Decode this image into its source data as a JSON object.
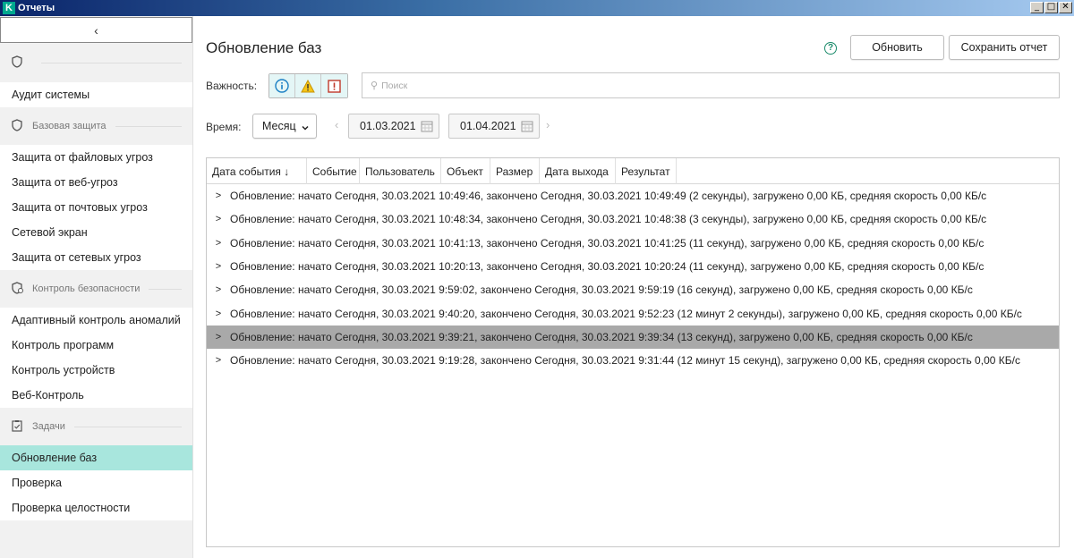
{
  "window": {
    "title": "Отчеты",
    "logo": "K",
    "controls": [
      "_",
      "□",
      "✕"
    ]
  },
  "sidebar": {
    "collapse_icon": "‹",
    "groups": [
      {
        "label": "",
        "icon": "shield-icon",
        "items": [
          "Аудит системы"
        ]
      },
      {
        "label": "Базовая защита",
        "icon": "shield-icon",
        "items": [
          "Защита от файловых угроз",
          "Защита от веб-угроз",
          "Защита от почтовых угроз",
          "Сетевой экран",
          "Защита от сетевых угроз"
        ]
      },
      {
        "label": "Контроль безопасности",
        "icon": "shield-check-icon",
        "items": [
          "Адаптивный контроль аномалий",
          "Контроль программ",
          "Контроль устройств",
          "Веб-Контроль"
        ]
      },
      {
        "label": "Задачи",
        "icon": "clipboard-icon",
        "items": [
          "Обновление баз",
          "Проверка",
          "Проверка целостности"
        ]
      }
    ],
    "active_item": "Обновление баз"
  },
  "header": {
    "title": "Обновление баз",
    "refresh_label": "Обновить",
    "save_report_label": "Сохранить отчет"
  },
  "filters": {
    "severity_label": "Важность:",
    "severity_buttons": [
      {
        "icon": "info-icon",
        "color": "#1a7fc4"
      },
      {
        "icon": "warning-icon",
        "color": "#e0a800"
      },
      {
        "icon": "critical-icon",
        "color": "#c0392b"
      }
    ],
    "search_placeholder": "Поиск",
    "time_label": "Время:",
    "period_value": "Месяц",
    "date_from": "01.03.2021",
    "date_to": "01.04.2021"
  },
  "table": {
    "columns": [
      "Дата события ↓",
      "Событие",
      "Пользователь",
      "Объект",
      "Размер",
      "Дата выхода",
      "Результат"
    ],
    "rows": [
      "Обновление: начато Сегодня, 30.03.2021 10:49:46, закончено Сегодня, 30.03.2021 10:49:49 (2 секунды), загружено 0,00 КБ, средняя скорость 0,00 КБ/с",
      "Обновление: начато Сегодня, 30.03.2021 10:48:34, закончено Сегодня, 30.03.2021 10:48:38 (3 секунды), загружено 0,00 КБ, средняя скорость 0,00 КБ/с",
      "Обновление: начато Сегодня, 30.03.2021 10:41:13, закончено Сегодня, 30.03.2021 10:41:25 (11 секунд), загружено 0,00 КБ, средняя скорость 0,00 КБ/с",
      "Обновление: начато Сегодня, 30.03.2021 10:20:13, закончено Сегодня, 30.03.2021 10:20:24 (11 секунд), загружено 0,00 КБ, средняя скорость 0,00 КБ/с",
      "Обновление: начато Сегодня, 30.03.2021 9:59:02, закончено Сегодня, 30.03.2021 9:59:19 (16 секунд), загружено 0,00 КБ, средняя скорость 0,00 КБ/с",
      "Обновление: начато Сегодня, 30.03.2021 9:40:20, закончено Сегодня, 30.03.2021 9:52:23 (12 минут 2 секунды), загружено 0,00 КБ, средняя скорость 0,00 КБ/с",
      "Обновление: начато Сегодня, 30.03.2021 9:39:21, закончено Сегодня, 30.03.2021 9:39:34 (13 секунд), загружено 0,00 КБ, средняя скорость 0,00 КБ/с",
      "Обновление: начато Сегодня, 30.03.2021 9:19:28, закончено Сегодня, 30.03.2021 9:31:44 (12 минут 15 секунд), загружено 0,00 КБ, средняя скорость 0,00 КБ/с"
    ],
    "selected_row_index": 6
  },
  "colors": {
    "accent": "#1a8a6a",
    "active_item_bg": "#a8e6dd",
    "selected_row_bg": "#a9a9a9"
  }
}
